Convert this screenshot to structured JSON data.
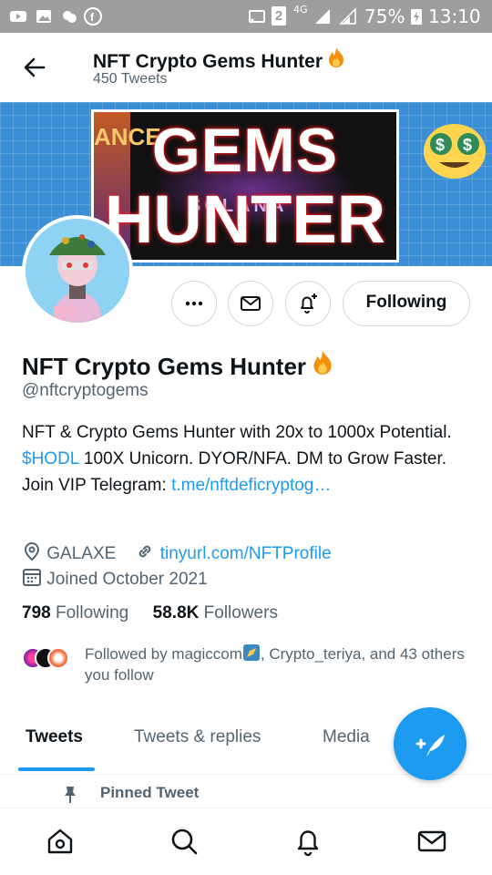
{
  "status_bar": {
    "signal_label": "4G",
    "sim_label": "2",
    "battery_percent": "75%",
    "time": "13:10"
  },
  "header": {
    "title": "NFT Crypto Gems Hunter",
    "tweet_count": "450 Tweets"
  },
  "banner": {
    "line1": "GEMS",
    "line2": "HUNTER",
    "side_text": "ANCE",
    "mid_text": "SOLANA"
  },
  "actions": {
    "following_label": "Following"
  },
  "profile": {
    "name": "NFT Crypto Gems Hunter",
    "handle": "@nftcryptogems",
    "bio_part1": "NFT & Crypto Gems Hunter with 20x to 1000x Potential. ",
    "bio_cashtag": "$HODL",
    "bio_part2": " 100X Unicorn. DYOR/NFA. DM to Grow Faster. Join VIP Telegram: ",
    "bio_link": "t.me/nftdeficryptog…",
    "location": "GALAXE",
    "website": "tinyurl.com/NFTProfile",
    "joined": "Joined October 2021"
  },
  "stats": {
    "following_count": "798",
    "following_label": "Following",
    "followers_count": "58.8K",
    "followers_label": "Followers"
  },
  "followed_by": {
    "text_part1": "Followed by magiccom",
    "text_part2": ", Crypto_teriya, and 43 others you follow"
  },
  "tabs": [
    {
      "label": "Tweets",
      "active": true
    },
    {
      "label": "Tweets & replies",
      "active": false
    },
    {
      "label": "Media",
      "active": false
    }
  ],
  "pinned": {
    "label": "Pinned Tweet"
  },
  "colors": {
    "accent": "#1d9bf0",
    "text_primary": "#0f1419",
    "text_secondary": "#536471",
    "status_bar": "#9e9e9e",
    "banner_bg": "#3a8fd6"
  },
  "icons": {
    "back": "arrow-left-icon",
    "more": "more-icon",
    "message": "envelope-icon",
    "notify": "bell-plus-icon",
    "location": "location-pin-icon",
    "link": "link-icon",
    "calendar": "calendar-icon",
    "compose": "compose-feather-icon",
    "pin": "pin-icon",
    "nav_home": "home-icon",
    "nav_search": "search-icon",
    "nav_notifications": "bell-icon",
    "nav_messages": "envelope-icon"
  }
}
